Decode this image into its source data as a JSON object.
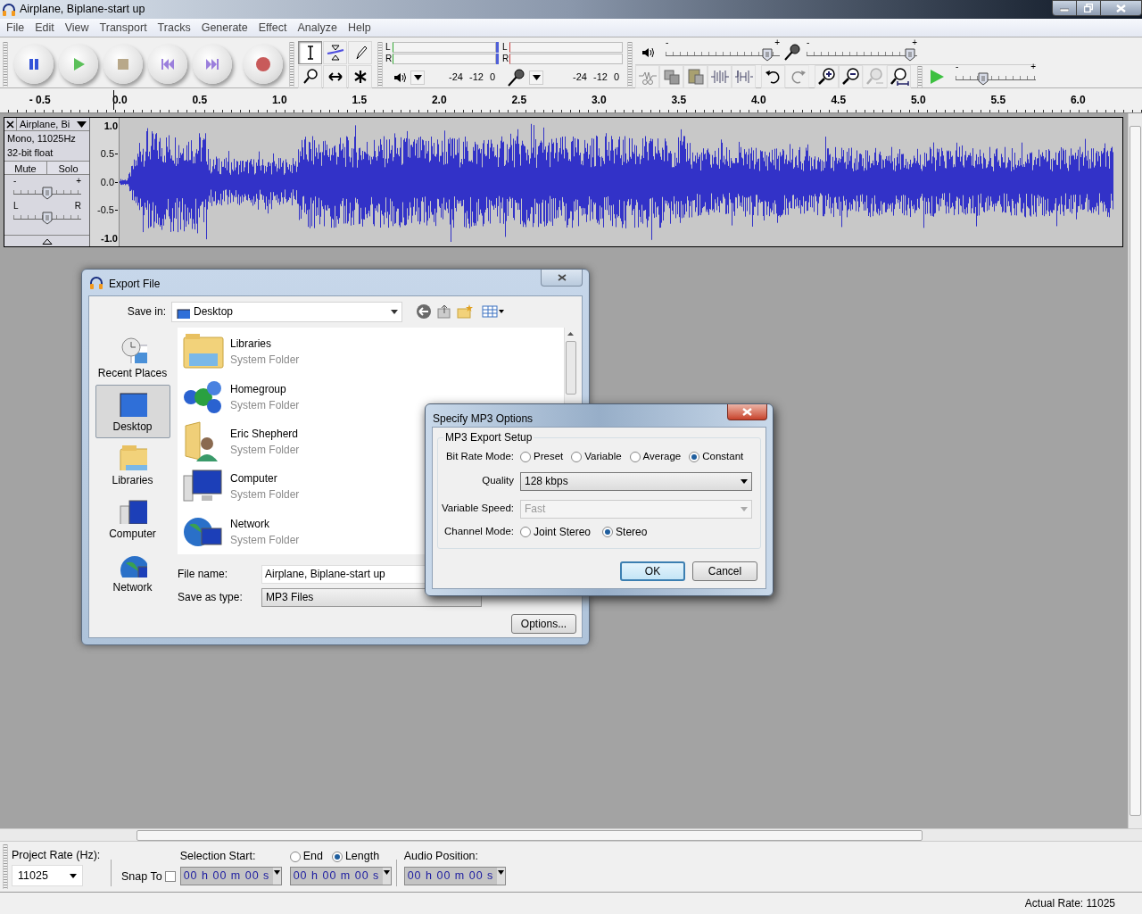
{
  "window": {
    "title": "Airplane, Biplane-start up"
  },
  "menu": [
    "File",
    "Edit",
    "View",
    "Transport",
    "Tracks",
    "Generate",
    "Effect",
    "Analyze",
    "Help"
  ],
  "tools": [
    {
      "kind": "select",
      "selected": true
    },
    {
      "kind": "envelope",
      "selected": false
    },
    {
      "kind": "draw",
      "selected": false
    },
    {
      "kind": "zoom",
      "selected": false
    },
    {
      "kind": "timeshift",
      "selected": false
    },
    {
      "kind": "multi",
      "selected": false
    }
  ],
  "meters": [
    {
      "kind": "output",
      "channels": [
        "L",
        "R"
      ],
      "ticks": [
        "-24",
        "-12",
        "0"
      ]
    },
    {
      "kind": "input",
      "channels": [
        "L",
        "R"
      ],
      "ticks": [
        "-24",
        "-12",
        "0"
      ]
    }
  ],
  "mixer": {
    "playback_volume": {
      "minus": "-",
      "plus": "+",
      "level": 0.93
    },
    "recording_volume": {
      "minus": "-",
      "plus": "+",
      "level": 0.98
    }
  },
  "edit_tools": [
    {
      "kind": "cut",
      "disabled": false
    },
    {
      "kind": "copy",
      "disabled": false
    },
    {
      "kind": "paste",
      "disabled": false
    },
    {
      "kind": "trim",
      "disabled": false
    },
    {
      "kind": "silence",
      "disabled": false
    },
    {
      "kind": "undo",
      "disabled": false
    },
    {
      "kind": "redo",
      "disabled": true
    },
    {
      "kind": "zoom_in",
      "disabled": false
    },
    {
      "kind": "zoom_out",
      "disabled": false
    },
    {
      "kind": "fit_selection",
      "disabled": true
    },
    {
      "kind": "fit_project",
      "disabled": false
    }
  ],
  "play_at_speed": {
    "minus": "-",
    "plus": "+",
    "level": 0.32
  },
  "ruler": [
    "- 0.5",
    "0.0",
    "0.5",
    "1.0",
    "1.5",
    "2.0",
    "2.5",
    "3.0",
    "3.5",
    "4.0",
    "4.5",
    "5.0",
    "5.5",
    "6.0"
  ],
  "track": {
    "name": "Airplane, Bi",
    "info": [
      "Mono, 11025Hz",
      "32-bit float"
    ],
    "mute": "Mute",
    "solo": "Solo",
    "gain": {
      "minus": "-",
      "plus": "+",
      "level": 0.5
    },
    "pan": {
      "left": "L",
      "right": "R",
      "level": 0.5
    },
    "scale": [
      "1.0",
      "0.5",
      "0.0",
      "-0.5",
      "-1.0"
    ]
  },
  "export_dialog": {
    "title": "Export File",
    "save_in_label": "Save in:",
    "save_in": "Desktop",
    "places": [
      {
        "kind": "recent",
        "label": "Recent Places",
        "selected": false
      },
      {
        "kind": "desktop",
        "label": "Desktop",
        "selected": true
      },
      {
        "kind": "libraries",
        "label": "Libraries",
        "selected": false
      },
      {
        "kind": "computer",
        "label": "Computer",
        "selected": false
      },
      {
        "kind": "network",
        "label": "Network",
        "selected": false
      }
    ],
    "items": [
      {
        "kind": "libraries",
        "name": "Libraries",
        "type": "System Folder"
      },
      {
        "kind": "homegroup",
        "name": "Homegroup",
        "type": "System Folder"
      },
      {
        "kind": "user",
        "name": "Eric Shepherd",
        "type": "System Folder"
      },
      {
        "kind": "computer",
        "name": "Computer",
        "type": "System Folder"
      },
      {
        "kind": "network",
        "name": "Network",
        "type": "System Folder"
      }
    ],
    "file_name_label": "File name:",
    "file_name": "Airplane, Biplane-start up",
    "save_as_type_label": "Save as type:",
    "save_as_type": "MP3 Files",
    "options_button": "Options..."
  },
  "mp3_dialog": {
    "title": "Specify MP3 Options",
    "group": "MP3 Export Setup",
    "bit_rate_mode_label": "Bit Rate Mode:",
    "bit_rate_modes": [
      {
        "label": "Preset",
        "selected": false
      },
      {
        "label": "Variable",
        "selected": false
      },
      {
        "label": "Average",
        "selected": false
      },
      {
        "label": "Constant",
        "selected": true
      }
    ],
    "quality_label": "Quality",
    "quality": {
      "value": "128 kbps",
      "disabled": false
    },
    "variable_speed_label": "Variable Speed:",
    "variable_speed": {
      "value": "Fast",
      "disabled": true
    },
    "channel_mode_label": "Channel Mode:",
    "channel_modes": [
      {
        "label": "Joint Stereo",
        "selected": false
      },
      {
        "label": "Stereo",
        "selected": true
      }
    ],
    "buttons": [
      {
        "label": "OK",
        "default": true
      },
      {
        "label": "Cancel",
        "default": false
      }
    ]
  },
  "selection_toolbar": {
    "project_rate_label": "Project Rate (Hz):",
    "project_rate": "11025",
    "snap_to": {
      "label": "Snap To",
      "checked": false
    },
    "selection_start_label": "Selection Start:",
    "end_length": [
      {
        "label": "End",
        "selected": false
      },
      {
        "label": "Length",
        "selected": true
      }
    ],
    "audio_position_label": "Audio Position:",
    "times": [
      "00 h 00 m 00 s",
      "00 h 00 m 00 s",
      "00 h 00 m 00 s"
    ]
  },
  "status_bar": {
    "actual_rate": "Actual Rate: 11025"
  }
}
